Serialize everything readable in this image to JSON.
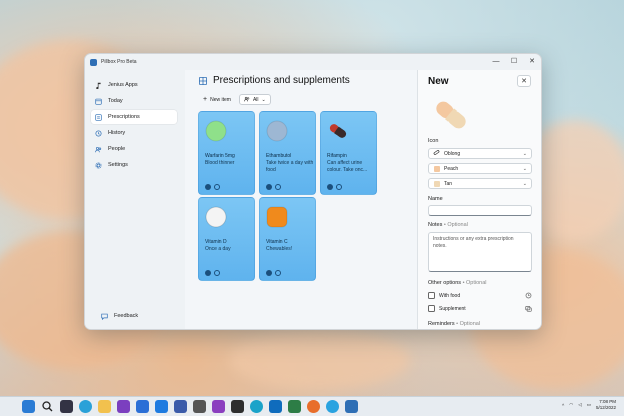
{
  "window": {
    "app_title": "Pillbox Pro Beta",
    "controls": {
      "minimize": "—",
      "maximize": "☐",
      "close": "✕"
    }
  },
  "sidebar": {
    "items": [
      {
        "label": "Jenius Apps",
        "icon": "music-note-icon",
        "active": false
      },
      {
        "label": "Today",
        "icon": "calendar-icon",
        "active": false
      },
      {
        "label": "Prescriptions",
        "icon": "list-icon",
        "active": true
      },
      {
        "label": "History",
        "icon": "history-icon",
        "active": false
      },
      {
        "label": "People",
        "icon": "people-icon",
        "active": false
      },
      {
        "label": "Settings",
        "icon": "gear-icon",
        "active": false
      }
    ],
    "feedback_label": "Feedback"
  },
  "main": {
    "title": "Prescriptions and supplements",
    "new_item_label": "New item",
    "filter_label": "All",
    "cards": [
      {
        "name": "Warfarin 5mg",
        "note": "Blood thinner",
        "pill_shape": "round",
        "pill_color": "#8fe08a"
      },
      {
        "name": "Ethambutol",
        "note": "Take twice a day with food",
        "pill_shape": "round",
        "pill_color": "#9db7d3"
      },
      {
        "name": "Rifampin",
        "note": "Can affect urine colour. Take onc...",
        "pill_shape": "capsule",
        "pill_color": "#c0392b"
      },
      {
        "name": "Vitamin D",
        "note": "Once a day",
        "pill_shape": "round",
        "pill_color": "#f4f4f4"
      },
      {
        "name": "Vitamin C",
        "note": "Chewables!",
        "pill_shape": "rounded-square",
        "pill_color": "#f08a1c"
      }
    ]
  },
  "panel": {
    "title": "New",
    "close_label": "✕",
    "icon_label": "Icon",
    "shape_value": "Oblong",
    "color1_value": "Peach",
    "color1_hex": "#f4c8a0",
    "color2_value": "Tan",
    "color2_hex": "#f0d8b4",
    "name_label": "Name",
    "notes_label": "Notes",
    "notes_optional": "• Optional",
    "notes_placeholder": "Instructions or any extra prescription notes.",
    "other_label": "Other options",
    "other_optional": "• Optional",
    "with_food_label": "With food",
    "supplement_label": "Supplement",
    "reminders_label": "Reminders",
    "reminders_optional": "• Optional"
  },
  "taskbar": {
    "time": "7:08 PM",
    "date": "5/12/2022"
  },
  "colors": {
    "card_blue": "#6bbcf1",
    "accent": "#1b4f7c"
  }
}
